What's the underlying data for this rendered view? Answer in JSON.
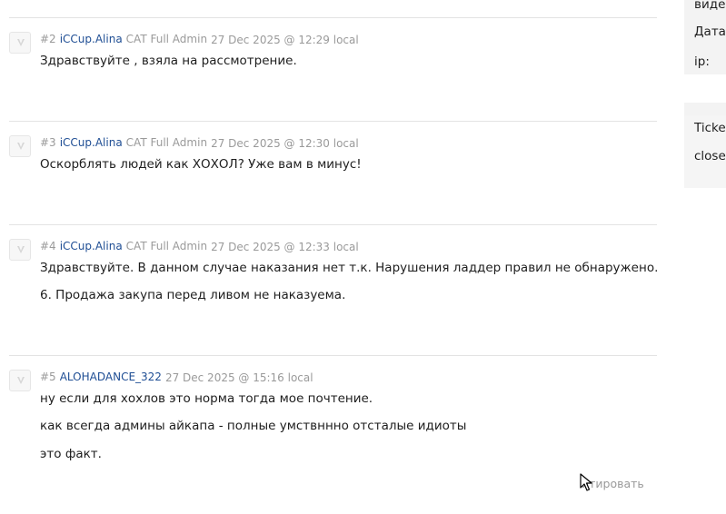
{
  "posts": [
    {
      "num": "#2",
      "author": "iCCup.Alina",
      "role": "CAT Full Admin",
      "date": "27 Dec 2025 @ 12:29 local",
      "lines": [
        "Здравствуйте , взяла на рассмотрение."
      ]
    },
    {
      "num": "#3",
      "author": "iCCup.Alina",
      "role": "CAT Full Admin",
      "date": "27 Dec 2025 @ 12:30 local",
      "lines": [
        "Оскорблять людей как ХОХОЛ? Уже вам в минус!"
      ]
    },
    {
      "num": "#4",
      "author": "iCCup.Alina",
      "role": "CAT Full Admin",
      "date": "27 Dec 2025 @ 12:33 local",
      "lines": [
        "Здравствуйте. В данном случае наказания нет т.к. Нарушения ладдер правил не обнаружено.",
        "6. Продажа закупа перед ливом не наказуема."
      ]
    },
    {
      "num": "#5",
      "author": "ALOHADANCE_322",
      "role": "",
      "date": "27 Dec 2025 @ 15:16 local",
      "lines": [
        "ну если для хохлов это норма тогда мое почтение.",
        "как всегда админы айкапа - полные умствнннo отсталые идиоты",
        "это факт."
      ]
    }
  ],
  "quote_label": "итировать",
  "sidebar": {
    "top_text": "виде",
    "date_label": "Дата",
    "ip_label": "ip:",
    "ticket_label": "Ticke",
    "closed_label": "close"
  }
}
